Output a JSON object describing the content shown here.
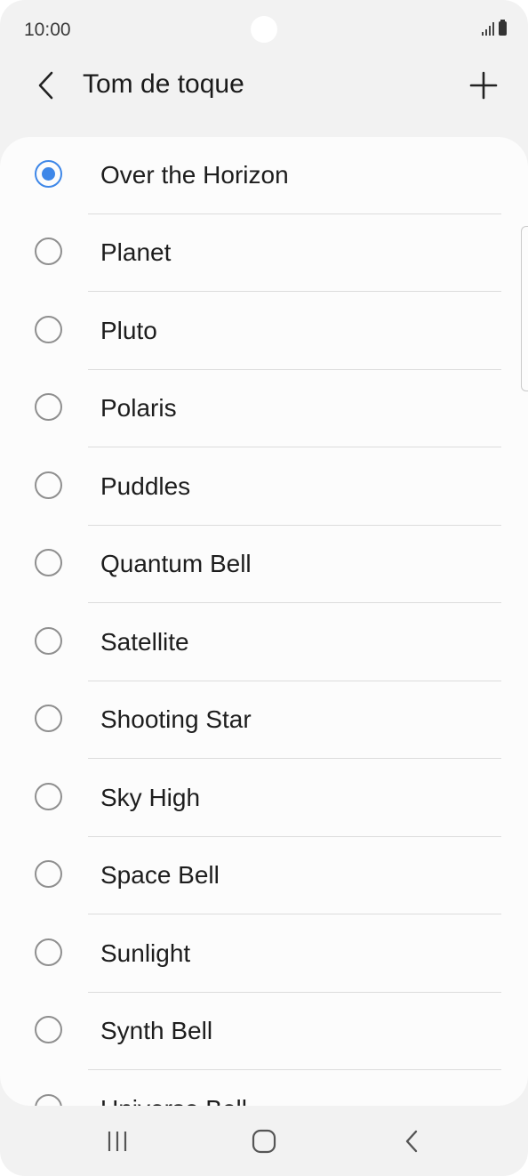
{
  "status_bar": {
    "time": "10:00",
    "signal_icon": "signal-icon",
    "battery_icon": "battery-icon"
  },
  "header": {
    "title": "Tom de toque",
    "back_icon": "chevron-left-icon",
    "add_icon": "plus-icon"
  },
  "ringtones": {
    "selected": "Over the Horizon",
    "items": [
      {
        "label": "Over the Horizon",
        "checked": true
      },
      {
        "label": "Planet",
        "checked": false
      },
      {
        "label": "Pluto",
        "checked": false
      },
      {
        "label": "Polaris",
        "checked": false
      },
      {
        "label": "Puddles",
        "checked": false
      },
      {
        "label": "Quantum Bell",
        "checked": false
      },
      {
        "label": "Satellite",
        "checked": false
      },
      {
        "label": "Shooting Star",
        "checked": false
      },
      {
        "label": "Sky High",
        "checked": false
      },
      {
        "label": "Space Bell",
        "checked": false
      },
      {
        "label": "Sunlight",
        "checked": false
      },
      {
        "label": "Synth Bell",
        "checked": false
      },
      {
        "label": "Universe Bell",
        "checked": false
      }
    ]
  },
  "nav_bar": {
    "recents_icon": "recents-icon",
    "home_icon": "home-icon",
    "back_icon": "back-icon"
  },
  "colors": {
    "accent": "#3e87e8",
    "background": "#f2f2f2",
    "card": "#fcfcfc"
  }
}
